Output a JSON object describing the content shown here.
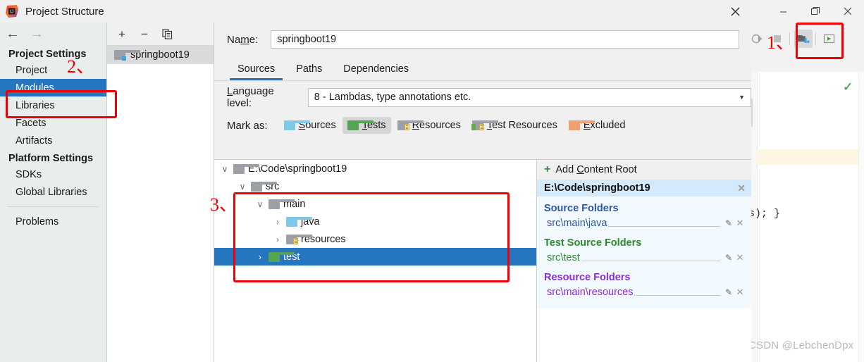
{
  "ide": {
    "window_controls": [
      "minimize",
      "restore",
      "close"
    ],
    "toolbar_icons": [
      "run-with-coverage-icon",
      "stop-icon",
      "project-structure-icon",
      "run-icon"
    ],
    "code_snippet": "s); }",
    "watermark": "CSDN @LebchenDpx",
    "check_icon": "checkmark-icon"
  },
  "dialog": {
    "title": "Project Structure",
    "app_icon": "intellij-idea-icon",
    "close_label": "✕"
  },
  "sidebar": {
    "back_icon": "arrow-left-icon",
    "forward_icon": "arrow-right-icon",
    "groups": [
      {
        "label": "Project Settings",
        "items": [
          {
            "label": "Project",
            "selected": false
          },
          {
            "label": "Modules",
            "selected": true
          },
          {
            "label": "Libraries",
            "selected": false
          },
          {
            "label": "Facets",
            "selected": false
          },
          {
            "label": "Artifacts",
            "selected": false
          }
        ]
      },
      {
        "label": "Platform Settings",
        "items": [
          {
            "label": "SDKs",
            "selected": false
          },
          {
            "label": "Global Libraries",
            "selected": false
          }
        ]
      }
    ],
    "problems_label": "Problems"
  },
  "modules": {
    "toolbar": {
      "add": "+",
      "remove": "−",
      "copy": "copy-icon"
    },
    "items": [
      {
        "label": "springboot19",
        "selected": true
      }
    ]
  },
  "content": {
    "name_label_pre": "Na",
    "name_label_key": "m",
    "name_label_post": "e:",
    "name_value": "springboot19",
    "tabs": [
      {
        "label": "Sources",
        "active": true
      },
      {
        "label": "Paths",
        "active": false
      },
      {
        "label": "Dependencies",
        "active": false
      }
    ],
    "language_level": {
      "label_pre": "",
      "label_key": "L",
      "label_post": "anguage level:",
      "value": "8 - Lambdas, type annotations etc.",
      "caret": "▼"
    },
    "mark_as": {
      "label": "Mark as:",
      "options": [
        {
          "label_key": "S",
          "label_rest": "ources",
          "icon": "folder-sources-icon",
          "pressed": false
        },
        {
          "label_key": "T",
          "label_rest": "ests",
          "icon": "folder-tests-icon",
          "pressed": true
        },
        {
          "label_key": "R",
          "label_rest": "esources",
          "icon": "folder-resources-icon",
          "pressed": false
        },
        {
          "label_key": "T",
          "label_rest": "est Resources",
          "icon": "folder-test-resources-icon",
          "pressed": false
        },
        {
          "label_key": "E",
          "label_rest": "xcluded",
          "icon": "folder-excluded-icon",
          "pressed": false
        }
      ]
    },
    "tree": [
      {
        "label": "E:\\Code\\springboot19",
        "indent": 0,
        "twisty": "∨",
        "icon": "folder-gray-icon",
        "selected": false
      },
      {
        "label": "src",
        "indent": 1,
        "twisty": "∨",
        "icon": "folder-gray-icon",
        "selected": false
      },
      {
        "label": "main",
        "indent": 2,
        "twisty": "∨",
        "icon": "folder-gray-icon",
        "selected": false
      },
      {
        "label": "java",
        "indent": 3,
        "twisty": "›",
        "icon": "folder-blue-icon",
        "selected": false
      },
      {
        "label": "resources",
        "indent": 3,
        "twisty": "›",
        "icon": "folder-resources-icon",
        "selected": false
      },
      {
        "label": "test",
        "indent": 2,
        "twisty": "›",
        "icon": "folder-green-icon",
        "selected": true
      }
    ],
    "detail": {
      "add_content_root_pre": "Add ",
      "add_content_root_key": "C",
      "add_content_root_post": "ontent Root",
      "root_path": "E:\\Code\\springboot19",
      "remove_label": "✕",
      "groups": [
        {
          "title": "Source Folders",
          "color": "#2a57a8",
          "paths": [
            "src\\main\\java"
          ]
        },
        {
          "title": "Test Source Folders",
          "color": "#2c8b2c",
          "paths": [
            "src\\test"
          ]
        },
        {
          "title": "Resource Folders",
          "color": "#8a2be2",
          "paths": [
            "src\\main\\resources"
          ]
        }
      ]
    }
  },
  "annotations": [
    {
      "number": "1、",
      "target": "project-structure-toolbar-button"
    },
    {
      "number": "2、",
      "target": "modules-sidebar-item"
    },
    {
      "number": "3、",
      "target": "source-tree-folders"
    }
  ],
  "colors": {
    "selection_blue": "#2675bf",
    "annotation_red": "#f00000",
    "source_folder": "#2a57a8",
    "test_folder": "#2c8b2c",
    "resource_folder": "#8a2be2",
    "header_highlight": "#d4eafa"
  }
}
